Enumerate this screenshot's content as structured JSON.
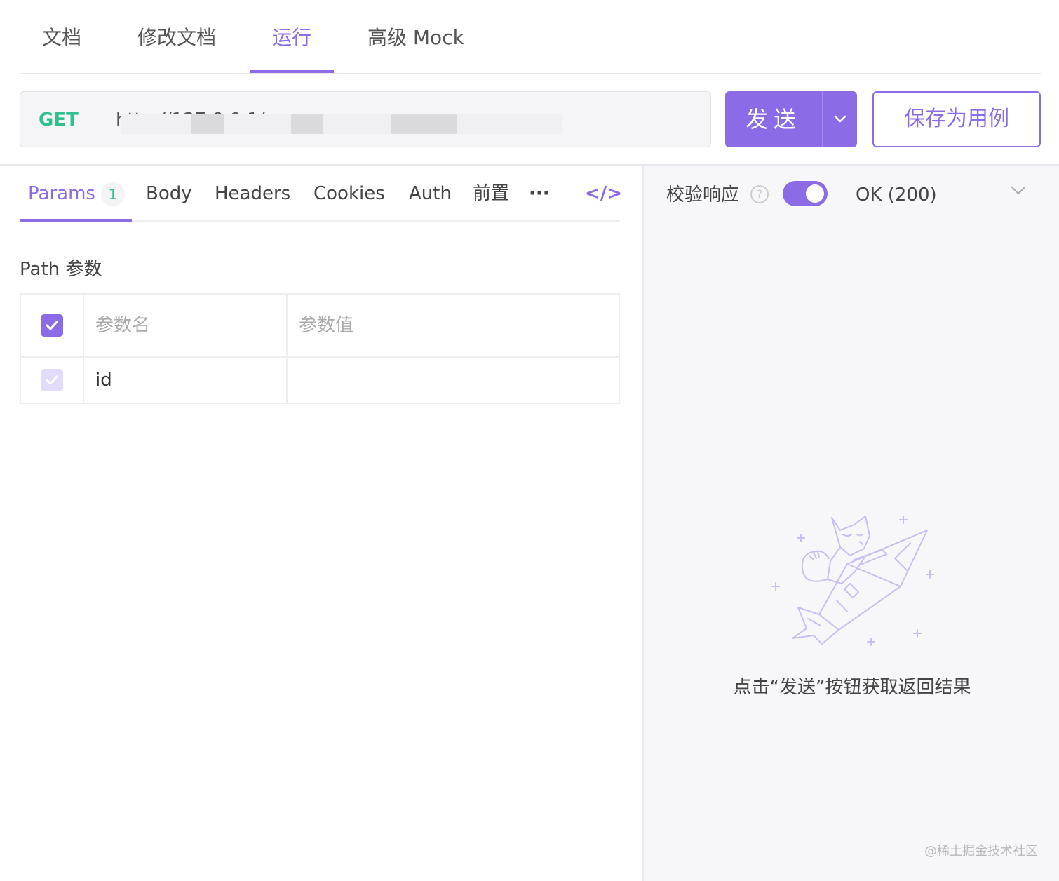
{
  "top_tabs": [
    {
      "label": "文档"
    },
    {
      "label": "修改文档"
    },
    {
      "label": "运行"
    },
    {
      "label": "高级 Mock"
    }
  ],
  "active_top_tab": "运行",
  "request": {
    "method": "GET",
    "url": "http://127.0.0.1/...",
    "send_label": "发送",
    "save_label": "保存为用例"
  },
  "sub_tabs": [
    {
      "label": "Params",
      "badge": "1"
    },
    {
      "label": "Body"
    },
    {
      "label": "Headers"
    },
    {
      "label": "Cookies"
    },
    {
      "label": "Auth"
    },
    {
      "label": "前置"
    },
    {
      "label": "···"
    }
  ],
  "code_icon": "</>",
  "path_params": {
    "title": "Path 参数",
    "columns": [
      "参数名",
      "参数值"
    ],
    "rows": [
      {
        "name": "id",
        "value": "",
        "checked": true
      }
    ]
  },
  "response": {
    "validate_label": "校验响应",
    "validate_enabled": true,
    "status": "OK (200)",
    "empty_hint": "点击“发送”按钮获取返回结果"
  },
  "watermark": "@稀土掘金技术社区",
  "colors": {
    "accent": "#8c6be6",
    "method_get": "#2fc08f"
  }
}
